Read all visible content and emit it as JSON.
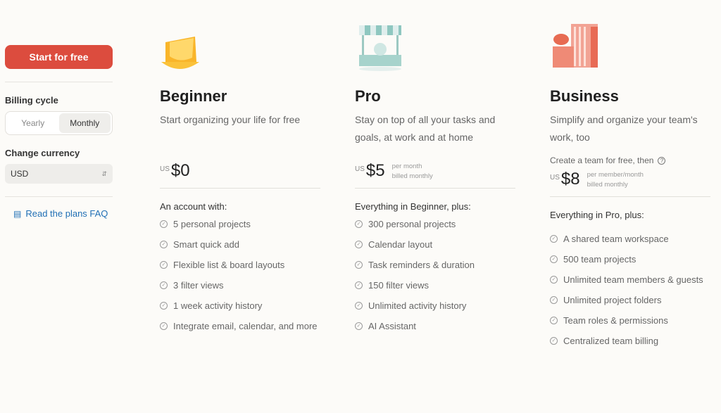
{
  "sidebar": {
    "start_label": "Start for free",
    "billing_label": "Billing cycle",
    "billing_options": [
      "Yearly",
      "Monthly"
    ],
    "billing_selected": "Monthly",
    "currency_label": "Change currency",
    "currency_value": "USD",
    "faq_label": "Read the plans FAQ"
  },
  "colors": {
    "accent": "#dc4c3e",
    "link": "#1f6fb5"
  },
  "plans": [
    {
      "name": "Beginner",
      "desc": "Start organizing your life for free",
      "note": "",
      "currency": "US",
      "price": "$0",
      "per1": "",
      "per2": "",
      "features_heading": "An account with:",
      "features": [
        "5 personal projects",
        "Smart quick add",
        "Flexible list & board layouts",
        "3 filter views",
        "1 week activity history",
        "Integrate email, calendar, and more"
      ]
    },
    {
      "name": "Pro",
      "desc": "Stay on top of all your tasks and goals, at work and at home",
      "note": "",
      "currency": "US",
      "price": "$5",
      "per1": "per month",
      "per2": "billed monthly",
      "features_heading": "Everything in Beginner, plus:",
      "features": [
        "300 personal projects",
        "Calendar layout",
        "Task reminders & duration",
        "150 filter views",
        "Unlimited activity history",
        "AI Assistant"
      ]
    },
    {
      "name": "Business",
      "desc": "Simplify and organize your team's work, too",
      "note": "Create a team for free, then",
      "currency": "US",
      "price": "$8",
      "per1": "per member/month",
      "per2": "billed monthly",
      "features_heading": "Everything in Pro, plus:",
      "features": [
        "A shared team workspace",
        "500 team projects",
        "Unlimited team members & guests",
        "Unlimited project folders",
        "Team roles & permissions",
        "Centralized team billing"
      ]
    }
  ]
}
